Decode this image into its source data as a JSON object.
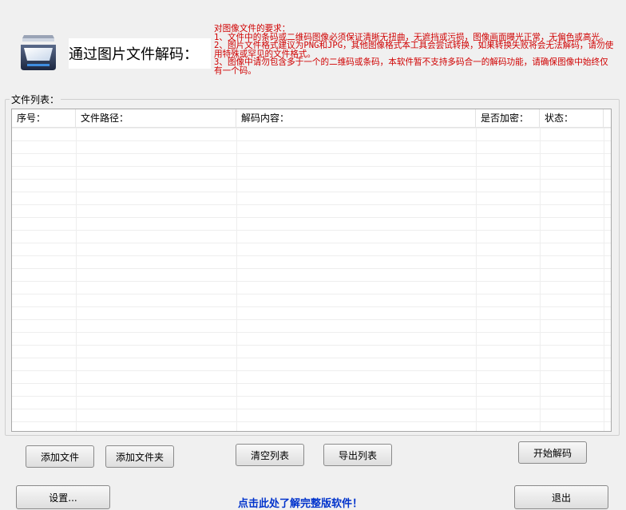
{
  "header": {
    "title": "通过图片文件解码：",
    "requirements": [
      "对图像文件的要求：",
      "1、文件中的条码或二维码图像必须保证清晰无扭曲，无遮挡或污损，图像画面曝光正常，无偏色或高光。",
      "2、图片文件格式建议为PNG和JPG，其他图像格式本工具会尝试转换，如果转换失败将会无法解码，请勿使用特殊或罕见的文件格式。",
      "3、图像中请勿包含多于一个的二维码或条码，本软件暂不支持多码合一的解码功能，请确保图像中始终仅有一个码。"
    ]
  },
  "file_list": {
    "label": "文件列表：",
    "columns": [
      "序号：",
      "文件路径：",
      "解码内容：",
      "是否加密：",
      "状态："
    ]
  },
  "buttons": {
    "add_file": "添加文件",
    "add_folder": "添加文件夹",
    "clear_list": "清空列表",
    "export_list": "导出列表",
    "start_decode": "开始解码",
    "settings": "设置...",
    "exit": "退出"
  },
  "footer": {
    "link_text": "点击此处了解完整版软件！"
  },
  "colors": {
    "requirements_text": "#d00000",
    "link_text": "#0033cc"
  },
  "icons": {
    "app_icon": "scanner-icon"
  }
}
